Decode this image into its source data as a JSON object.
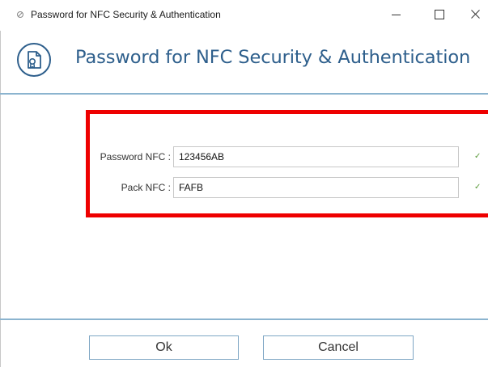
{
  "window": {
    "title": "Password for NFC Security & Authentication",
    "icon": "key-badge-icon"
  },
  "header": {
    "title": "Password for NFC Security & Authentication",
    "icon": "document-badge-icon",
    "accent_color": "#2e5f8c"
  },
  "form": {
    "password_label": "Password NFC :",
    "password_value": "123456AB",
    "pack_label": "Pack NFC :",
    "pack_value": "FAFB",
    "valid_mark": "✓"
  },
  "buttons": {
    "ok_label": "Ok",
    "cancel_label": "Cancel"
  },
  "colors": {
    "highlight_border": "#ee0000",
    "separator": "#8bb4cf",
    "button_border": "#7ea6c4",
    "check": "#5a9a3a"
  }
}
